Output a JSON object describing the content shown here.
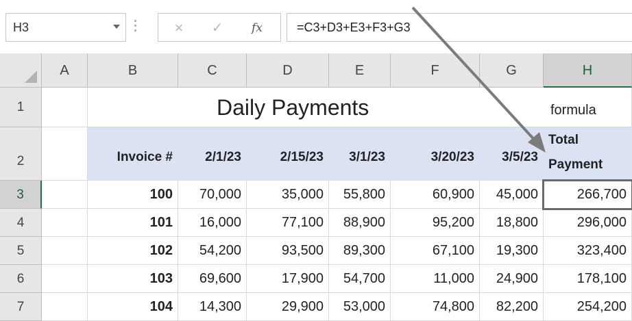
{
  "formula_bar": {
    "name_box": "H3",
    "cancel_symbol": "×",
    "enter_symbol": "✓",
    "fx_symbol": "fx",
    "formula": "=C3+D3+E3+F3+G3"
  },
  "sheet": {
    "columns": [
      "A",
      "B",
      "C",
      "D",
      "E",
      "F",
      "G",
      "H"
    ],
    "selected_column": "H",
    "rows": [
      "1",
      "2",
      "3",
      "4",
      "5",
      "6",
      "7"
    ],
    "selected_row": "3",
    "title": "Daily Payments",
    "note": "formula",
    "headers": [
      "Invoice #",
      "2/1/23",
      "2/15/23",
      "3/1/23",
      "3/20/23",
      "3/5/23"
    ],
    "total_header_line1": "Total",
    "total_header_line2": "Payment",
    "data": [
      [
        "100",
        "70,000",
        "35,000",
        "55,800",
        "60,900",
        "45,000",
        "266,700"
      ],
      [
        "101",
        "16,000",
        "77,100",
        "88,900",
        "95,200",
        "18,800",
        "296,000"
      ],
      [
        "102",
        "54,200",
        "93,500",
        "89,300",
        "67,100",
        "19,300",
        "323,400"
      ],
      [
        "103",
        "69,600",
        "17,900",
        "54,700",
        "11,000",
        "24,900",
        "178,100"
      ],
      [
        "104",
        "14,300",
        "29,900",
        "53,000",
        "74,800",
        "82,200",
        "254,200"
      ]
    ]
  },
  "colors": {
    "header_fill": "#dbe3f3",
    "arrow": "#7b7b7b",
    "selection": "#217346"
  }
}
